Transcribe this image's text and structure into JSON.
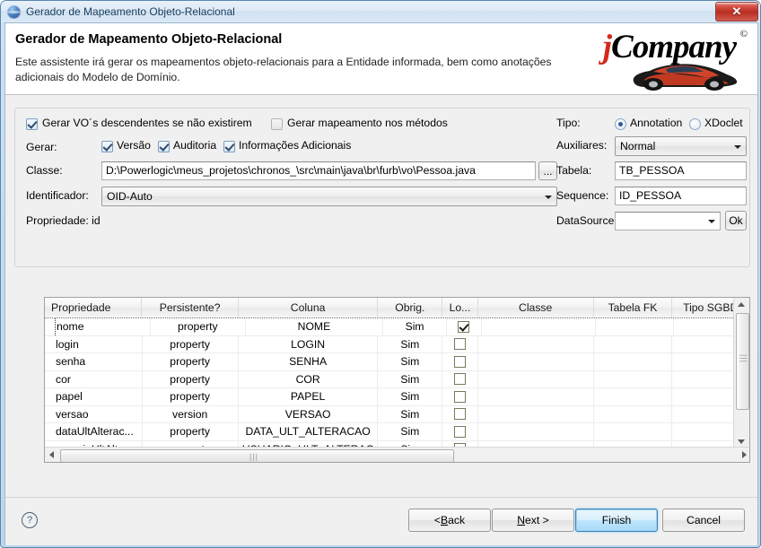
{
  "window": {
    "title": "Gerador de Mapeamento Objeto-Relacional",
    "close_label": "✕",
    "icon": "globe-icon"
  },
  "header": {
    "title": "Gerador de Mapeamento Objeto-Relacional",
    "description": "Este assistente irá gerar os mapeamentos objeto-relacionais para a Entidade informada, bem como anotações adicionais do Modelo de Domínio.",
    "logo_j": "j",
    "logo_company": "Company",
    "logo_copyright": "©"
  },
  "form": {
    "gerar_vo_label": "Gerar VO´s descendentes se não existirem",
    "gerar_vo_checked": true,
    "gerar_mapeamento_label": "Gerar mapeamento nos métodos",
    "gerar_mapeamento_checked": false,
    "gerar_label": "Gerar:",
    "versao_label": "Versão",
    "versao_checked": true,
    "auditoria_label": "Auditoria",
    "auditoria_checked": true,
    "info_adicionais_label": "Informações Adicionais",
    "info_adicionais_checked": true,
    "classe_label": "Classe:",
    "classe_value": "D:\\Powerlogic\\meus_projetos\\chronos_\\src\\main\\java\\br\\furb\\vo\\Pessoa.java",
    "browse_label": "...",
    "identificador_label": "Identificador:",
    "identificador_value": "OID-Auto",
    "propriedade_label": "Propriedade: id",
    "tipo_label": "Tipo:",
    "tipo_annotation_label": "Annotation",
    "tipo_xdoclet_label": "XDoclet",
    "tipo_selected": "Annotation",
    "auxiliares_label": "Auxiliares:",
    "auxiliares_value": "Normal",
    "tabela_label": "Tabela:",
    "tabela_value": "TB_PESSOA",
    "sequence_label": "Sequence:",
    "sequence_value": "ID_PESSOA",
    "datasource_label": "DataSource:",
    "datasource_value": "",
    "ok_label": "Ok"
  },
  "table": {
    "columns": [
      "Propriedade",
      "Persistente?",
      "Coluna",
      "Obrig.",
      "Lo...",
      "Classe",
      "Tabela FK",
      "Tipo SGBD"
    ],
    "rows": [
      {
        "propriedade": "nome",
        "persistente": "property",
        "coluna": "NOME",
        "obrig": "Sim",
        "lo": true,
        "classe": "",
        "tabela_fk": "",
        "tipo_sgbd": ""
      },
      {
        "propriedade": "login",
        "persistente": "property",
        "coluna": "LOGIN",
        "obrig": "Sim",
        "lo": false,
        "classe": "",
        "tabela_fk": "",
        "tipo_sgbd": ""
      },
      {
        "propriedade": "senha",
        "persistente": "property",
        "coluna": "SENHA",
        "obrig": "Sim",
        "lo": false,
        "classe": "",
        "tabela_fk": "",
        "tipo_sgbd": ""
      },
      {
        "propriedade": "cor",
        "persistente": "property",
        "coluna": "COR",
        "obrig": "Sim",
        "lo": false,
        "classe": "",
        "tabela_fk": "",
        "tipo_sgbd": ""
      },
      {
        "propriedade": "papel",
        "persistente": "property",
        "coluna": "PAPEL",
        "obrig": "Sim",
        "lo": false,
        "classe": "",
        "tabela_fk": "",
        "tipo_sgbd": ""
      },
      {
        "propriedade": "versao",
        "persistente": "version",
        "coluna": "VERSAO",
        "obrig": "Sim",
        "lo": false,
        "classe": "",
        "tabela_fk": "",
        "tipo_sgbd": ""
      },
      {
        "propriedade": "dataUltAlterac...",
        "persistente": "property",
        "coluna": "DATA_ULT_ALTERACAO",
        "obrig": "Sim",
        "lo": false,
        "classe": "",
        "tabela_fk": "",
        "tipo_sgbd": ""
      },
      {
        "propriedade": "usuarioUltAlte",
        "persistente": "property",
        "coluna": "USUARIO_ULT_ALTERAC",
        "obrig": "Sim",
        "lo": false,
        "classe": "",
        "tabela_fk": "",
        "tipo_sgbd": ""
      }
    ]
  },
  "footer": {
    "help_label": "?",
    "back_prefix": "< ",
    "back_key": "B",
    "back_suffix": "ack",
    "next_key": "N",
    "next_suffix": "ext >",
    "finish_label": "Finish",
    "cancel_label": "Cancel"
  }
}
